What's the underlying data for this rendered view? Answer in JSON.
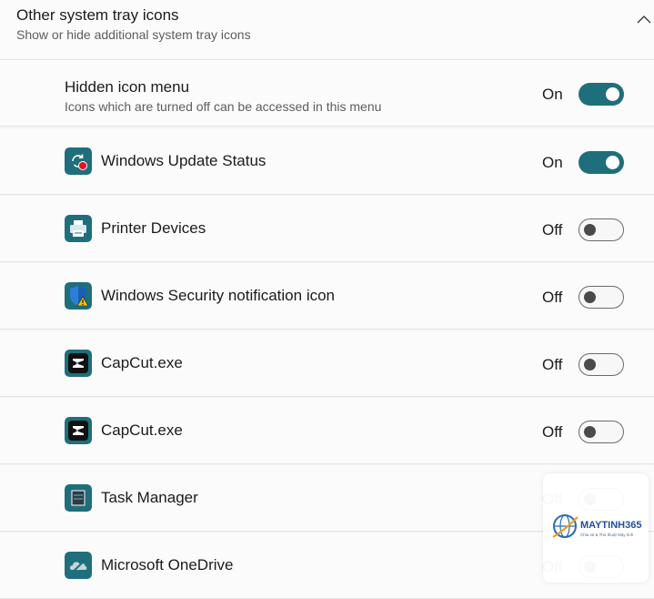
{
  "section": {
    "title": "Other system tray icons",
    "subtitle": "Show or hide additional system tray icons",
    "chevron_icon": "chevron-up-icon"
  },
  "hidden_menu": {
    "title": "Hidden icon menu",
    "description": "Icons which are turned off can be accessed in this menu",
    "state": "On",
    "on": true
  },
  "items": [
    {
      "label": "Windows Update Status",
      "state": "On",
      "on": true,
      "icon": "windows-update-icon"
    },
    {
      "label": "Printer Devices",
      "state": "Off",
      "on": false,
      "icon": "printer-icon"
    },
    {
      "label": "Windows Security notification icon",
      "state": "Off",
      "on": false,
      "icon": "shield-warning-icon"
    },
    {
      "label": "CapCut.exe",
      "state": "Off",
      "on": false,
      "icon": "capcut-icon"
    },
    {
      "label": "CapCut.exe",
      "state": "Off",
      "on": false,
      "icon": "capcut-icon"
    },
    {
      "label": "Task Manager",
      "state": "Off",
      "on": false,
      "icon": "task-manager-icon"
    },
    {
      "label": "Microsoft OneDrive",
      "state": "Off",
      "on": false,
      "icon": "onedrive-icon"
    }
  ],
  "watermark": {
    "brand": "MAYTINH365",
    "tagline": "Chia sẻ & Thủ thuật Máy tính"
  },
  "colors": {
    "toggle_on": "#1e6f7b",
    "icon_teal": "#1e6f7b"
  }
}
